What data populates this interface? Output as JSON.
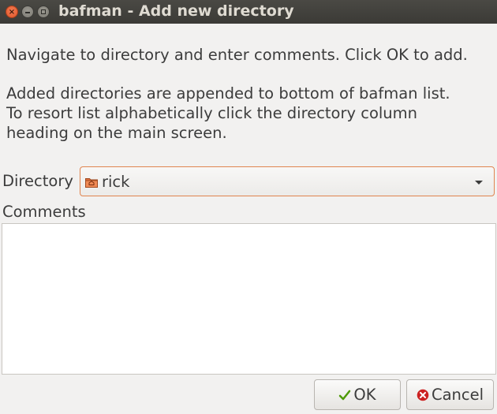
{
  "window": {
    "title": "bafman - Add new directory",
    "controls": [
      "close-icon",
      "minimize-icon",
      "maximize-icon"
    ]
  },
  "instructions": {
    "line1": "Navigate to directory and enter comments. Click OK to add.",
    "line2": "Added directories are appended to bottom of bafman list.",
    "line3": "To resort list alphabetically click the directory column",
    "line4": "heading on the main screen."
  },
  "directory": {
    "label": "Directory",
    "value": "rick",
    "icon": "folder-home-icon"
  },
  "comments": {
    "label": "Comments",
    "value": ""
  },
  "buttons": {
    "ok_label": "OK",
    "cancel_label": "Cancel"
  },
  "colors": {
    "titlebar": "#3b3a36",
    "accent": "#e0844f",
    "close": "#e0562a",
    "ok_check": "#4e9a06",
    "cancel_icon": "#cc2222"
  }
}
